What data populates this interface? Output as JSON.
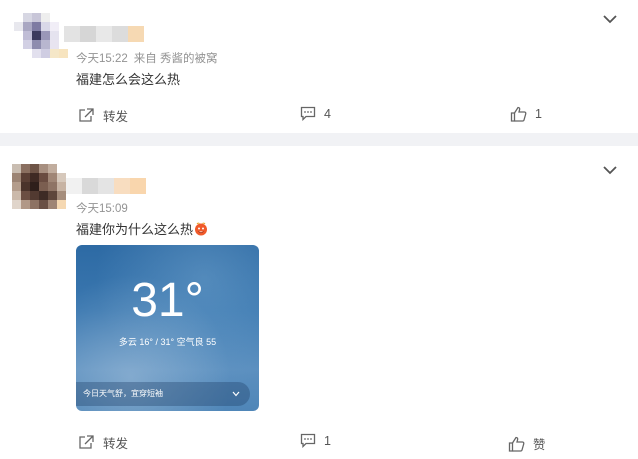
{
  "posts": [
    {
      "time": "今天15:22",
      "via": "来自 秀酱的被窝",
      "text": "福建怎么会这么热",
      "actions": {
        "repost": "转发",
        "comments": "4",
        "likes": "1"
      }
    },
    {
      "time": "今天15:09",
      "text": "福建你为什么这么热",
      "emoji": "hot-face-emoji",
      "weather_card": {
        "temperature": "31°",
        "summary": "多云  16° / 31°  空气良 55",
        "tip": "今日天气舒，宜穿短袖"
      },
      "actions": {
        "repost": "转发",
        "comments": "1",
        "likes": "赞"
      }
    }
  ],
  "colors": {
    "meta": "#939393",
    "separator": "#f1f2f5",
    "text": "#333333"
  }
}
